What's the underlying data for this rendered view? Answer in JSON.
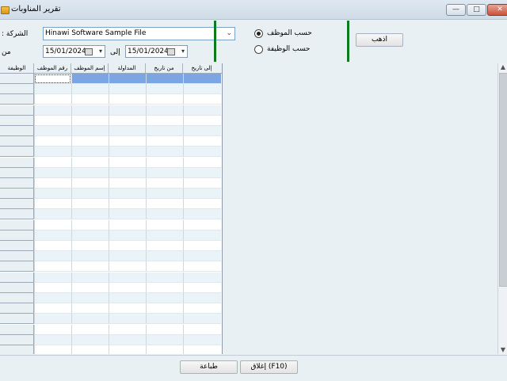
{
  "window": {
    "title": "تقرير المناوبات",
    "minimize": "—",
    "maximize": "□",
    "close": "✕"
  },
  "filters": {
    "company_label": ": الشركة",
    "company_value": "Hinawi Software Sample File",
    "from_label": "من",
    "to_label": "إلى",
    "from_date": "15/01/2024",
    "to_date": "15/01/2024",
    "by_employee": "حسب الموظف",
    "by_job": "حسب الوظيفة",
    "selected": "by_employee"
  },
  "actions": {
    "go": "اذهب",
    "print": "طباعة",
    "close": "إغلاق (F10)"
  },
  "grid": {
    "columns": [
      "الوظيفة",
      "رقم الموظف",
      "إسم الموظف",
      "المداولة",
      "من تاريخ",
      "إلى تاريخ"
    ],
    "row_count": 27,
    "selected_row": 0
  },
  "colors": {
    "accent_green": "#0d7a1f",
    "selection_blue": "#7ca5e3"
  }
}
